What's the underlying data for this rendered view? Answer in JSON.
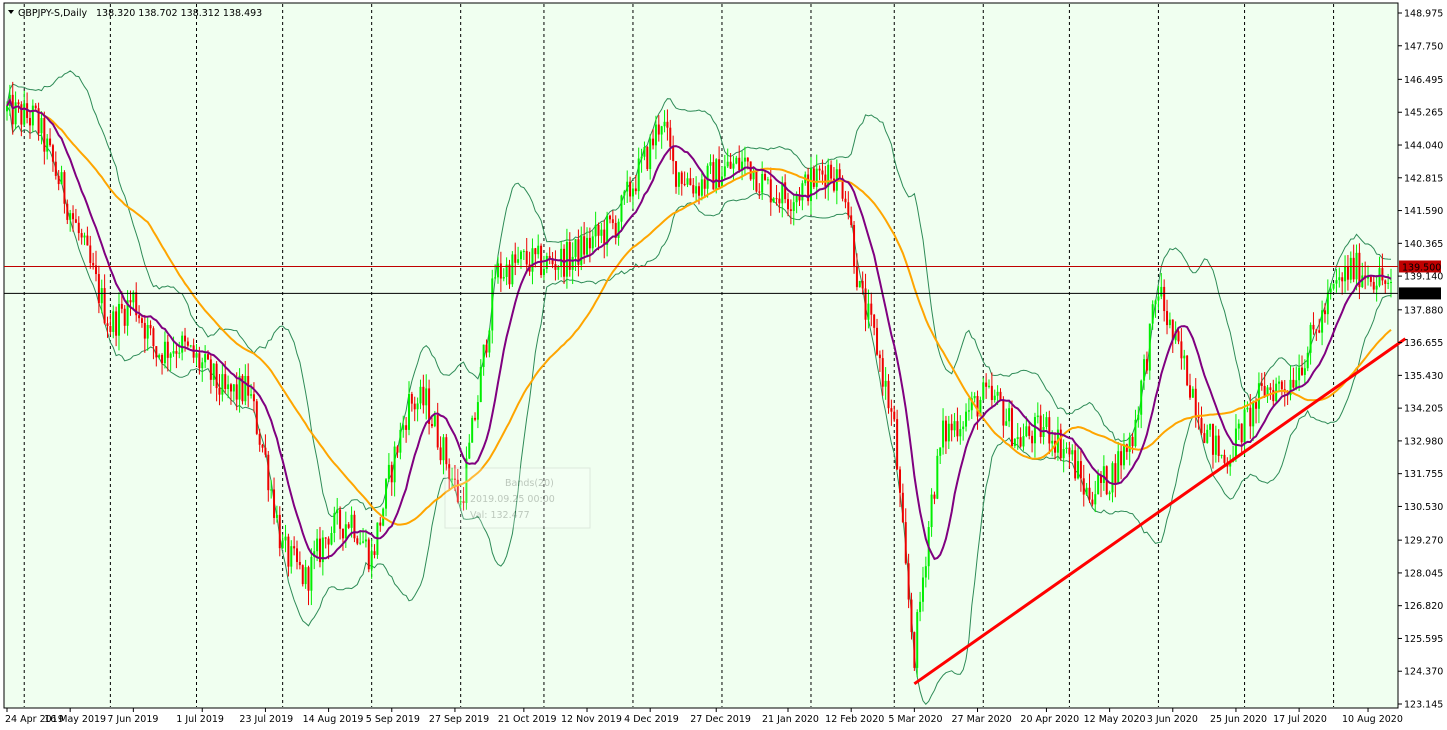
{
  "header": {
    "symbol": "GBPJPY-S,Daily",
    "ohlc": "138.320 138.702 138.312 138.493"
  },
  "tooltip": {
    "line1": "Bands(20)",
    "line2": "2019.09.25 00:00",
    "line3": "Val: 132.477"
  },
  "chart_data": {
    "type": "candlestick",
    "instrument": "GBPJPY-S",
    "timeframe": "Daily",
    "last_ohlc": {
      "open": 138.32,
      "high": 138.702,
      "low": 138.312,
      "close": 138.493
    },
    "ylim": [
      123.145,
      148.975
    ],
    "y_ticks": [
      148.975,
      147.75,
      146.495,
      145.265,
      144.04,
      142.815,
      141.59,
      140.365,
      139.14,
      137.88,
      136.655,
      135.43,
      134.205,
      132.98,
      131.755,
      130.53,
      129.27,
      128.045,
      126.82,
      125.595,
      124.37,
      123.145
    ],
    "x_labels": [
      {
        "label": "24 Apr 2019",
        "day": 0
      },
      {
        "label": "16 May 2019",
        "day": 22
      },
      {
        "label": "7 Jun 2019",
        "day": 44
      },
      {
        "label": "1 Jul 2019",
        "day": 68
      },
      {
        "label": "23 Jul 2019",
        "day": 90
      },
      {
        "label": "14 Aug 2019",
        "day": 112
      },
      {
        "label": "5 Sep 2019",
        "day": 134
      },
      {
        "label": "27 Sep 2019",
        "day": 156
      },
      {
        "label": "21 Oct 2019",
        "day": 180
      },
      {
        "label": "12 Nov 2019",
        "day": 202
      },
      {
        "label": "4 Dec 2019",
        "day": 224
      },
      {
        "label": "27 Dec 2019",
        "day": 247
      },
      {
        "label": "21 Jan 2020",
        "day": 272
      },
      {
        "label": "12 Feb 2020",
        "day": 294
      },
      {
        "label": "5 Mar 2020",
        "day": 316
      },
      {
        "label": "27 Mar 2020",
        "day": 338
      },
      {
        "label": "20 Apr 2020",
        "day": 362
      },
      {
        "label": "12 May 2020",
        "day": 384
      },
      {
        "label": "3 Jun 2020",
        "day": 406
      },
      {
        "label": "25 Jun 2020",
        "day": 428
      },
      {
        "label": "17 Jul 2020",
        "day": 450
      },
      {
        "label": "10 Aug 2020",
        "day": 474
      }
    ],
    "vertical_separators_day": [
      6,
      36,
      66,
      96,
      127,
      158,
      187,
      218,
      249,
      280,
      309,
      340,
      370,
      401,
      431,
      462
    ],
    "price_path": [
      {
        "day": 0,
        "price": 145.3
      },
      {
        "day": 10,
        "price": 145.0
      },
      {
        "day": 22,
        "price": 141.6
      },
      {
        "day": 36,
        "price": 137.3
      },
      {
        "day": 44,
        "price": 138.3
      },
      {
        "day": 52,
        "price": 136.3
      },
      {
        "day": 60,
        "price": 136.6
      },
      {
        "day": 68,
        "price": 135.8
      },
      {
        "day": 76,
        "price": 134.7
      },
      {
        "day": 84,
        "price": 134.9
      },
      {
        "day": 90,
        "price": 132.3
      },
      {
        "day": 96,
        "price": 128.9
      },
      {
        "day": 104,
        "price": 127.8
      },
      {
        "day": 112,
        "price": 129.6
      },
      {
        "day": 120,
        "price": 130.1
      },
      {
        "day": 127,
        "price": 128.6
      },
      {
        "day": 134,
        "price": 132.0
      },
      {
        "day": 140,
        "price": 134.4
      },
      {
        "day": 146,
        "price": 134.4
      },
      {
        "day": 152,
        "price": 132.6
      },
      {
        "day": 158,
        "price": 130.6
      },
      {
        "day": 164,
        "price": 134.6
      },
      {
        "day": 170,
        "price": 139.2
      },
      {
        "day": 180,
        "price": 139.7
      },
      {
        "day": 187,
        "price": 139.6
      },
      {
        "day": 196,
        "price": 139.8
      },
      {
        "day": 202,
        "price": 140.3
      },
      {
        "day": 212,
        "price": 141.1
      },
      {
        "day": 218,
        "price": 142.6
      },
      {
        "day": 224,
        "price": 143.9
      },
      {
        "day": 228,
        "price": 145.1
      },
      {
        "day": 232,
        "price": 143.2
      },
      {
        "day": 240,
        "price": 142.5
      },
      {
        "day": 249,
        "price": 143.1
      },
      {
        "day": 258,
        "price": 143.4
      },
      {
        "day": 264,
        "price": 142.5
      },
      {
        "day": 272,
        "price": 142.1
      },
      {
        "day": 280,
        "price": 142.6
      },
      {
        "day": 286,
        "price": 143.2
      },
      {
        "day": 292,
        "price": 142.4
      },
      {
        "day": 297,
        "price": 138.5
      },
      {
        "day": 303,
        "price": 136.5
      },
      {
        "day": 309,
        "price": 133.4
      },
      {
        "day": 313,
        "price": 128.0
      },
      {
        "day": 316,
        "price": 125.0
      },
      {
        "day": 322,
        "price": 130.8
      },
      {
        "day": 326,
        "price": 133.2
      },
      {
        "day": 332,
        "price": 133.8
      },
      {
        "day": 340,
        "price": 134.6
      },
      {
        "day": 346,
        "price": 134.3
      },
      {
        "day": 352,
        "price": 133.0
      },
      {
        "day": 362,
        "price": 133.5
      },
      {
        "day": 370,
        "price": 132.5
      },
      {
        "day": 376,
        "price": 131.0
      },
      {
        "day": 384,
        "price": 131.6
      },
      {
        "day": 392,
        "price": 133.2
      },
      {
        "day": 401,
        "price": 138.7
      },
      {
        "day": 406,
        "price": 136.8
      },
      {
        "day": 412,
        "price": 135.2
      },
      {
        "day": 418,
        "price": 133.2
      },
      {
        "day": 424,
        "price": 132.2
      },
      {
        "day": 431,
        "price": 133.6
      },
      {
        "day": 438,
        "price": 134.9
      },
      {
        "day": 446,
        "price": 135.1
      },
      {
        "day": 452,
        "price": 136.2
      },
      {
        "day": 458,
        "price": 137.6
      },
      {
        "day": 462,
        "price": 138.6
      },
      {
        "day": 468,
        "price": 139.4
      },
      {
        "day": 474,
        "price": 139.3
      },
      {
        "day": 480,
        "price": 138.9
      },
      {
        "day": 482,
        "price": 138.493
      }
    ],
    "horizontal_lines": [
      {
        "price": 139.5,
        "label": "139.500",
        "color": "#c00000"
      },
      {
        "price": 138.493,
        "label": "138.493",
        "color": "#000000"
      }
    ],
    "trendline": {
      "from": {
        "day": 316,
        "price": 123.9
      },
      "to": {
        "day": 487,
        "price": 136.8
      },
      "color": "#ff0000"
    },
    "colors": {
      "bull_candle": "#00ee00",
      "bear_candle": "#ee0000",
      "ma_fast": "#800080",
      "ma_slow": "#ffa500",
      "bands": "#2e8b57",
      "background": "#f0fff0"
    },
    "grid": false
  }
}
